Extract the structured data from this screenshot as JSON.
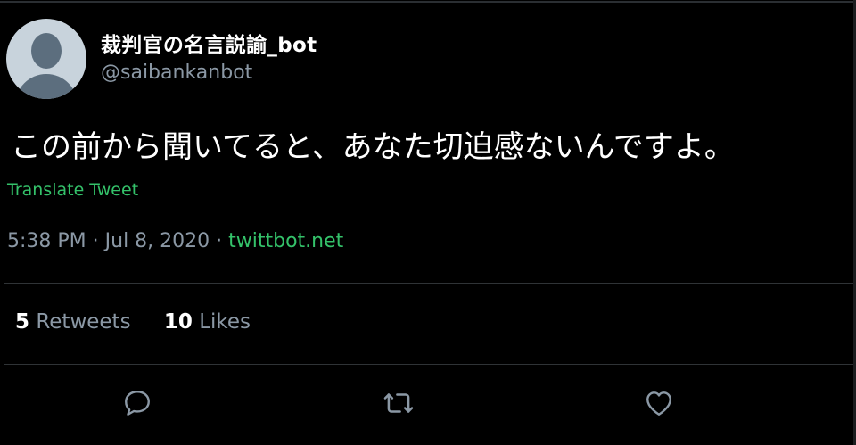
{
  "tweet": {
    "author": {
      "display_name": "裁判官の名言説諭_bot",
      "handle": "@saibankanbot"
    },
    "text": "この前から聞いてると、あなた切迫感ないんですよ。",
    "translate_label": "Translate Tweet",
    "time": "5:38 PM",
    "separator": " · ",
    "date": "Jul 8, 2020",
    "source": "twittbot.net",
    "stats": {
      "retweets_count": "5",
      "retweets_label": "Retweets",
      "likes_count": "10",
      "likes_label": "Likes"
    },
    "actions": {
      "reply_icon": "reply-icon",
      "retweet_icon": "retweet-icon",
      "like_icon": "heart-icon"
    }
  },
  "colors": {
    "background": "#000000",
    "text": "#ffffff",
    "muted": "#8b98a5",
    "accent_green": "#34c26a",
    "divider": "#2f3336"
  }
}
